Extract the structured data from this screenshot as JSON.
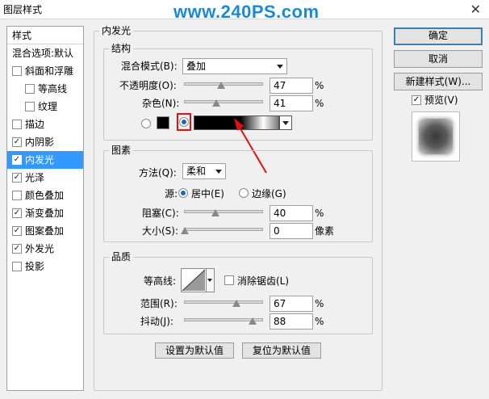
{
  "window": {
    "title": "图层样式",
    "watermark": "www.240PS.com",
    "close_label": "✕"
  },
  "stylelist": {
    "header": "样式",
    "blend_options": "混合选项:默认",
    "items": [
      {
        "label": "斜面和浮雕",
        "checked": false,
        "sub": false,
        "selected": false
      },
      {
        "label": "等高线",
        "checked": false,
        "sub": true,
        "selected": false
      },
      {
        "label": "纹理",
        "checked": false,
        "sub": true,
        "selected": false
      },
      {
        "label": "描边",
        "checked": false,
        "sub": false,
        "selected": false
      },
      {
        "label": "内阴影",
        "checked": true,
        "sub": false,
        "selected": false
      },
      {
        "label": "内发光",
        "checked": true,
        "sub": false,
        "selected": true
      },
      {
        "label": "光泽",
        "checked": true,
        "sub": false,
        "selected": false
      },
      {
        "label": "颜色叠加",
        "checked": false,
        "sub": false,
        "selected": false
      },
      {
        "label": "渐变叠加",
        "checked": true,
        "sub": false,
        "selected": false
      },
      {
        "label": "图案叠加",
        "checked": true,
        "sub": false,
        "selected": false
      },
      {
        "label": "外发光",
        "checked": true,
        "sub": false,
        "selected": false
      },
      {
        "label": "投影",
        "checked": false,
        "sub": false,
        "selected": false
      }
    ]
  },
  "panel": {
    "title": "内发光",
    "structure": {
      "title": "结构",
      "blend_mode_label": "混合模式(B):",
      "blend_mode_value": "叠加",
      "opacity_label": "不透明度(O):",
      "opacity_value": "47",
      "opacity_unit": "%",
      "opacity_fraction": 0.47,
      "noise_label": "杂色(N):",
      "noise_value": "41",
      "noise_unit": "%",
      "noise_fraction": 0.41,
      "color_swatch": "#000000",
      "gradient_selected": true
    },
    "elements": {
      "title": "图素",
      "method_label": "方法(Q):",
      "method_value": "柔和",
      "source_label": "源:",
      "source_center": "居中(E)",
      "source_edge": "边缘(G)",
      "choke_label": "阻塞(C):",
      "choke_value": "40",
      "choke_unit": "%",
      "choke_fraction": 0.4,
      "size_label": "大小(S):",
      "size_value": "0",
      "size_unit": "像素",
      "size_fraction": 0
    },
    "quality": {
      "title": "品质",
      "contour_label": "等高线:",
      "antialias_label": "消除锯齿(L)",
      "antialias_checked": false,
      "range_label": "范围(R):",
      "range_value": "67",
      "range_unit": "%",
      "range_fraction": 0.67,
      "jitter_label": "抖动(J):",
      "jitter_value": "88",
      "jitter_unit": "%",
      "jitter_fraction": 0.88
    },
    "set_default": "设置为默认值",
    "reset_default": "复位为默认值"
  },
  "buttons": {
    "ok": "确定",
    "cancel": "取消",
    "new_style": "新建样式(W)...",
    "preview_label": "预览(V)",
    "preview_checked": true
  },
  "colors": {
    "selection": "#3399ff",
    "annotation_red": "#e01010"
  }
}
